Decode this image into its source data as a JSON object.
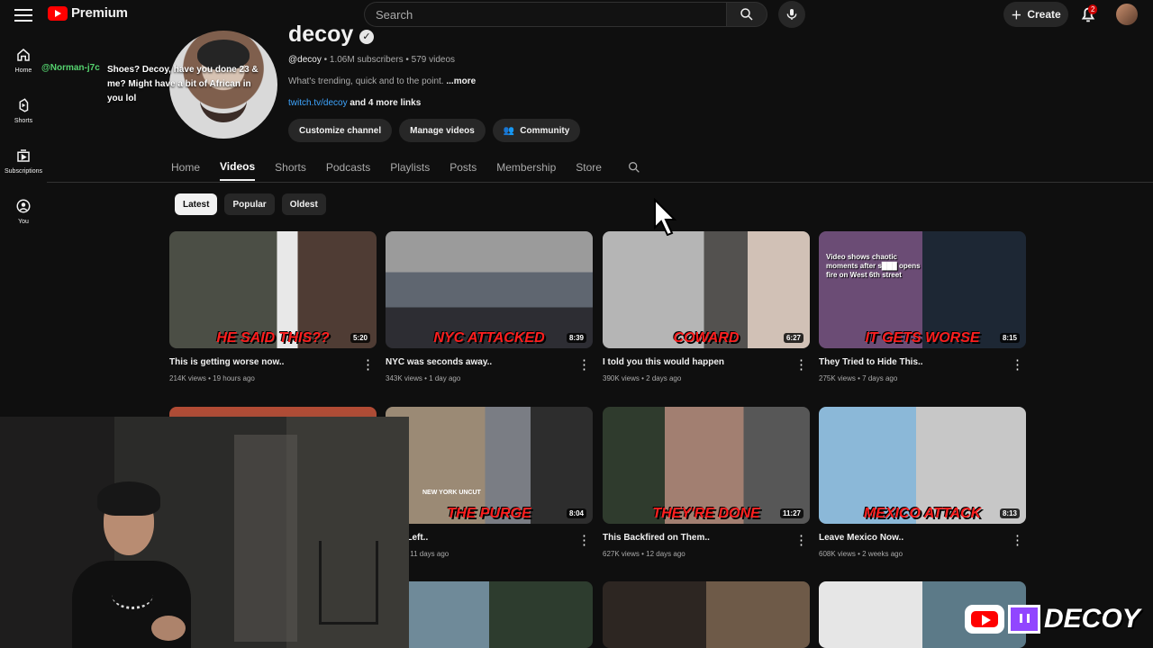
{
  "topbar": {
    "brand": "Premium",
    "search_placeholder": "Search",
    "create": "Create",
    "notifications_count": "2"
  },
  "sidebar": {
    "items": [
      {
        "label": "Home",
        "icon": "home-icon"
      },
      {
        "label": "Shorts",
        "icon": "shorts-icon"
      },
      {
        "label": "Subscriptions",
        "icon": "subscriptions-icon"
      },
      {
        "label": "You",
        "icon": "user-icon"
      }
    ]
  },
  "chat": {
    "user": "@Norman-j7c",
    "message": "Shoes? Decoy, have you done 23 & me? Might have a bit of African in you lol"
  },
  "channel": {
    "name": "decoy",
    "handle": "@decoy",
    "subscribers": "1.06M subscribers",
    "videos": "579 videos",
    "description": "What's trending, quick and to the point.",
    "more": "...more",
    "link": "twitch.tv/decoy",
    "more_links": "and 4 more links",
    "buttons": [
      "Customize channel",
      "Manage videos",
      "Community"
    ]
  },
  "tabs": [
    "Home",
    "Videos",
    "Shorts",
    "Podcasts",
    "Playlists",
    "Posts",
    "Membership",
    "Store"
  ],
  "filters": [
    "Latest",
    "Popular",
    "Oldest"
  ],
  "videos": [
    {
      "title": "This is getting worse now..",
      "meta": "214K views • 19 hours ago",
      "duration": "5:20",
      "overlay": "HE SAID THIS??",
      "theme": "linear-gradient(90deg,#4b4e45 0 52%,#e8e8e8 52% 62%,#4f3c34 62%)"
    },
    {
      "title": "NYC was seconds away..",
      "meta": "343K views • 1 day ago",
      "duration": "8:39",
      "overlay": "NYC ATTACKED",
      "theme": "linear-gradient(180deg,#9b9b9b 0 35%,#5f6670 35% 65%,#2d2d33 65%)"
    },
    {
      "title": "I told you this would happen",
      "meta": "390K views • 2 days ago",
      "duration": "6:27",
      "overlay": "COWARD",
      "theme": "linear-gradient(90deg,#b5b5b5 0 49%,#53514f 49% 70%,#d1c1b6 70%)"
    },
    {
      "title": "They Tried to Hide This..",
      "meta": "275K views • 7 days ago",
      "duration": "8:15",
      "overlay": "IT GETS WORSE",
      "theme": "linear-gradient(90deg,#6b4c75 0 50%,#1d2734 50%)"
    },
    {
      "title": "",
      "meta": "",
      "duration": "",
      "overlay": "",
      "theme": "linear-gradient(180deg,#b34b34,#555)"
    },
    {
      "title": "Just Left..",
      "meta": "views • 11 days ago",
      "duration": "8:04",
      "overlay": "THE PURGE",
      "theme": "linear-gradient(90deg,#9b8a75 0 48%,#7a7d84 48% 70%,#2d2d2d 70%)"
    },
    {
      "title": "This Backfired on Them..",
      "meta": "627K views • 12 days ago",
      "duration": "11:27",
      "overlay": "THEY'RE DONE",
      "theme": "linear-gradient(90deg,#2f3b2d 0 30%,#a27f71 30% 68%,#575757 68%)"
    },
    {
      "title": "Leave Mexico Now..",
      "meta": "608K views • 2 weeks ago",
      "duration": "8:13",
      "overlay": "MEXICO ATTACK",
      "theme": "linear-gradient(90deg,#8bb8d8 0 47%,#c7c7c7 47%)"
    },
    {
      "title": "",
      "meta": "",
      "duration": "",
      "overlay": "",
      "theme": "linear-gradient(90deg,#6f8a99 0 50%,#2d3c2e 50%)"
    },
    {
      "title": "",
      "meta": "",
      "duration": "",
      "overlay": "",
      "theme": "linear-gradient(90deg,#2d2622 0 50%,#6e5a48 50%)"
    },
    {
      "title": "",
      "meta": "",
      "duration": "",
      "overlay": "",
      "theme": "linear-gradient(90deg,#e6e6e6 0 50%,#5c7a88 50%)"
    }
  ],
  "thumbnail_captions": {
    "fourth": "Video shows chaotic moments after s███ opens fire on West 6th street",
    "sixth": "NEW YORK UNCUT"
  },
  "stream_logo_text": "DECOY",
  "colors": {
    "background": "#0f0f0f",
    "accent": "#ff0000",
    "link": "#3ea6ff",
    "text": "#f1f1f1"
  }
}
